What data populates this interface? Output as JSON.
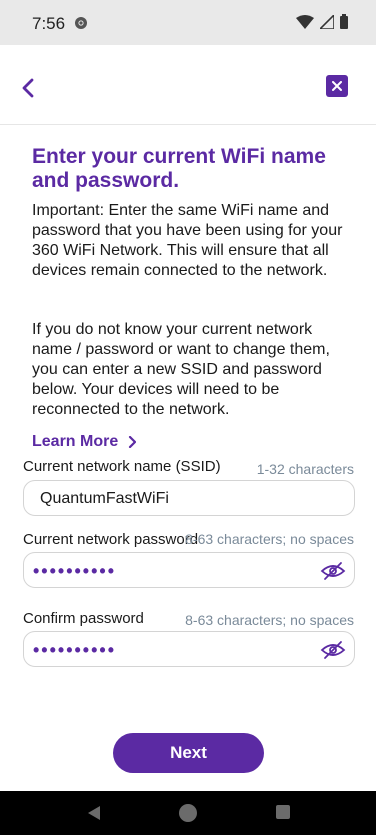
{
  "status_bar": {
    "time": "7:56"
  },
  "content": {
    "title": "Enter your current WiFi name and password.",
    "paragraph1": "Important: Enter the same WiFi name and password that you have been using for your 360 WiFi Network. This will ensure that all devices remain connected to the network.",
    "paragraph2": "If you do not know your current network name / password or want to change them, you can enter a new SSID and password below. Your devices will need to be reconnected to the network.",
    "learn_more": "Learn More"
  },
  "form": {
    "ssid": {
      "label": "Current network name (SSID)",
      "hint": "1-32 characters",
      "value": "QuantumFastWiFi"
    },
    "password": {
      "label": "Current network password",
      "hint": "8-63 characters; no spaces",
      "masked": "••••••••••"
    },
    "confirm": {
      "label": "Confirm password",
      "hint": "8-63 characters; no spaces",
      "masked": "••••••••••"
    }
  },
  "actions": {
    "next": "Next"
  },
  "colors": {
    "accent": "#5b2aa3",
    "hint": "#7a8a99"
  }
}
